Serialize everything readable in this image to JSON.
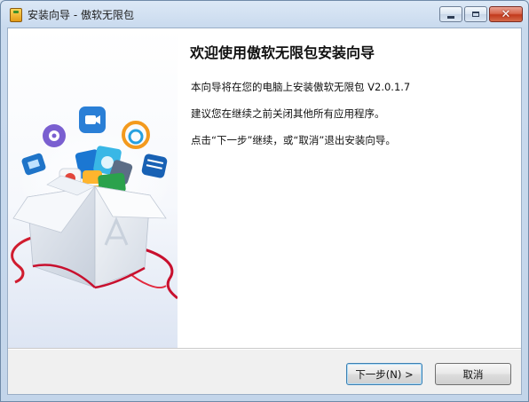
{
  "window": {
    "title": "安装向导 - 傲软无限包",
    "controls": {
      "minimize_icon": "minimize-icon",
      "maximize_icon": "maximize-icon",
      "close_glyph": "✕"
    }
  },
  "wizard": {
    "heading": "欢迎使用傲软无限包安装向导",
    "lines": [
      "本向导将在您的电脑上安装傲软无限包 V2.0.1.7",
      "建议您在继续之前关闭其他所有应用程序。",
      "点击“下一步”继续，或“取消”退出安装向导。"
    ]
  },
  "buttons": {
    "next_label": "下一步(N) >",
    "cancel_label": "取消"
  },
  "banner": {
    "image": "gift-box-with-app-icons",
    "box_letter": "A"
  },
  "colors": {
    "accent_blue": "#3c7fb1",
    "ribbon_red": "#c8102e",
    "close_red": "#c2391c"
  }
}
